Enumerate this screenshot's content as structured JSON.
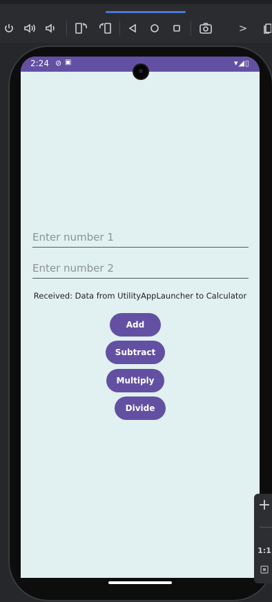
{
  "toolbar": {
    "tools": [
      "power",
      "volume-up",
      "volume-down",
      "rotate-left",
      "rotate-right",
      "back",
      "home",
      "overview",
      "screenshot",
      "more"
    ],
    "more_label": ">"
  },
  "statusbar": {
    "time": "2:24",
    "icons": "▾◢▯"
  },
  "form": {
    "number1_placeholder": "Enter number 1",
    "number2_placeholder": "Enter number 2",
    "received_text": "Received: Data from UtilityAppLauncher to Calculator"
  },
  "buttons": {
    "add": "Add",
    "subtract": "Subtract",
    "multiply": "Multiply",
    "divide": "Divide"
  },
  "zoom": {
    "plus": "+",
    "one_to_one": "1:1"
  },
  "colors": {
    "accent": "#6350a3",
    "screen_bg": "#e1f0f0"
  }
}
